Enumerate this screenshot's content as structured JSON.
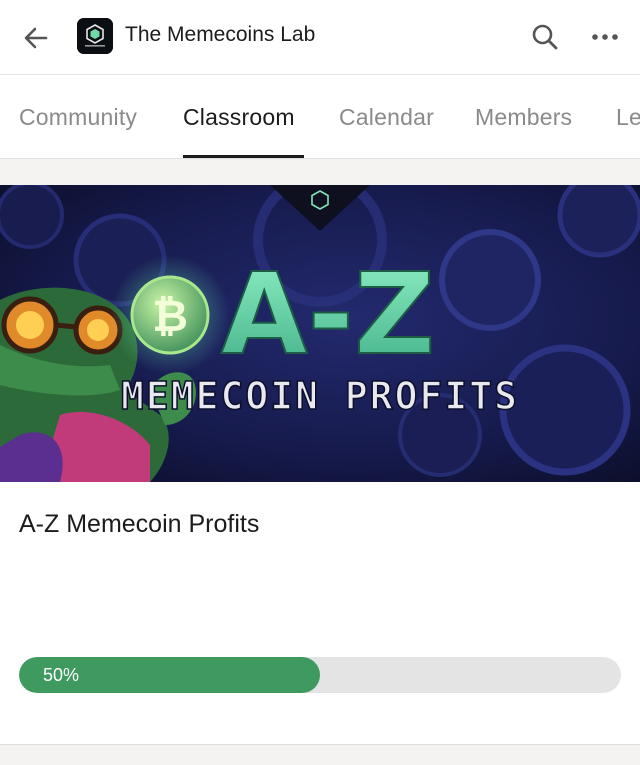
{
  "appbar": {
    "title": "The Memecoins Lab",
    "back_icon": "arrow-left-icon",
    "search_icon": "search-icon",
    "more_icon": "more-horizontal-icon",
    "logo_icon": "memecoins-lab-logo"
  },
  "tabs": [
    {
      "label": "Community",
      "active": false
    },
    {
      "label": "Classroom",
      "active": true
    },
    {
      "label": "Calendar",
      "active": false
    },
    {
      "label": "Members",
      "active": false
    },
    {
      "label": "Le",
      "active": false
    }
  ],
  "course": {
    "banner": {
      "headline": "A-Z",
      "subheadline": "MEMECOIN PROFITS",
      "coin_icon": "bitcoin-icon"
    },
    "title": "A-Z Memecoin Profits",
    "progress": {
      "value": 0.5,
      "label": "50%"
    }
  },
  "colors": {
    "accent": "#3e9a5e",
    "track": "#e4e4e4",
    "banner_bg": "#16194a",
    "banner_text": "#5fd6a0"
  }
}
